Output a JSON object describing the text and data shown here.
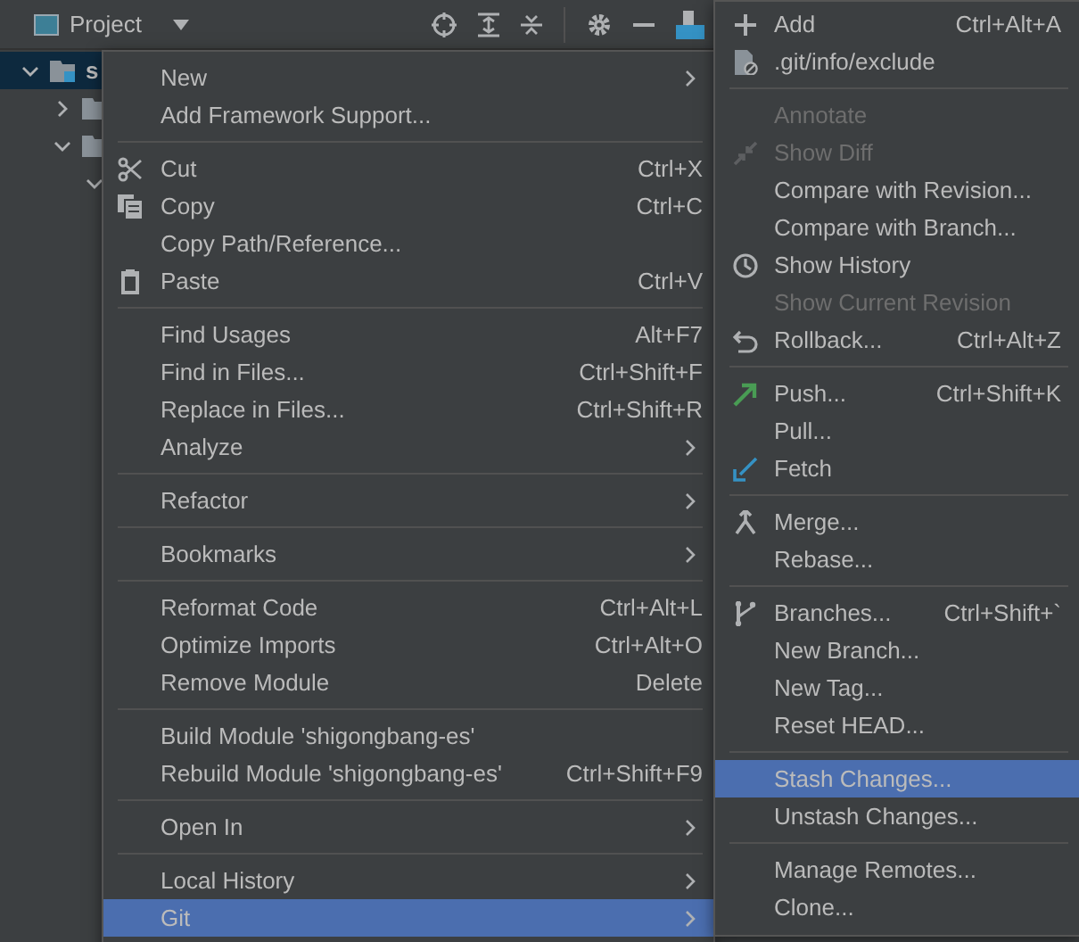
{
  "panel": {
    "title": "Project"
  },
  "tree": [
    {
      "label": "s",
      "selected": true,
      "expanded": true,
      "children": [
        {
          "expanded": false
        },
        {
          "expanded": true,
          "children": [
            {
              "expanded": true
            }
          ]
        }
      ]
    }
  ],
  "context_menu": {
    "groups": [
      [
        {
          "label": "New",
          "submenu": true,
          "selected": false
        },
        {
          "label": "Add Framework Support...",
          "selected": false
        }
      ],
      [
        {
          "label": "Cut",
          "kind": "scissors",
          "shortcut": "Ctrl+X",
          "selected": false
        },
        {
          "label": "Copy",
          "kind": "copy",
          "shortcut": "Ctrl+C",
          "selected": false
        },
        {
          "label": "Copy Path/Reference...",
          "selected": false
        },
        {
          "label": "Paste",
          "kind": "paste",
          "shortcut": "Ctrl+V",
          "selected": false
        }
      ],
      [
        {
          "label": "Find Usages",
          "shortcut": "Alt+F7",
          "selected": false
        },
        {
          "label": "Find in Files...",
          "shortcut": "Ctrl+Shift+F",
          "selected": false
        },
        {
          "label": "Replace in Files...",
          "shortcut": "Ctrl+Shift+R",
          "selected": false
        },
        {
          "label": "Analyze",
          "submenu": true,
          "selected": false
        }
      ],
      [
        {
          "label": "Refactor",
          "submenu": true,
          "selected": false
        }
      ],
      [
        {
          "label": "Bookmarks",
          "submenu": true,
          "selected": false
        }
      ],
      [
        {
          "label": "Reformat Code",
          "shortcut": "Ctrl+Alt+L",
          "selected": false
        },
        {
          "label": "Optimize Imports",
          "shortcut": "Ctrl+Alt+O",
          "selected": false
        },
        {
          "label": "Remove Module",
          "shortcut": "Delete",
          "selected": false
        }
      ],
      [
        {
          "label": "Build Module 'shigongbang-es'",
          "selected": false
        },
        {
          "label": "Rebuild Module 'shigongbang-es'",
          "shortcut": "Ctrl+Shift+F9",
          "selected": false
        }
      ],
      [
        {
          "label": "Open In",
          "submenu": true,
          "selected": false
        }
      ],
      [
        {
          "label": "Local History",
          "submenu": true,
          "selected": false
        },
        {
          "label": "Git",
          "submenu": true,
          "selected": true
        }
      ]
    ]
  },
  "git_submenu": {
    "groups": [
      [
        {
          "label": "Add",
          "kind": "plus",
          "shortcut": "Ctrl+Alt+A",
          "disabled": false,
          "selected": false
        },
        {
          "label": ".git/info/exclude",
          "kind": "file",
          "disabled": false,
          "selected": false
        }
      ],
      [
        {
          "label": "Annotate",
          "disabled": true,
          "selected": false
        },
        {
          "label": "Show Diff",
          "kind": "diff",
          "disabled": true,
          "selected": false
        },
        {
          "label": "Compare with Revision...",
          "disabled": false,
          "selected": false
        },
        {
          "label": "Compare with Branch...",
          "disabled": false,
          "selected": false
        },
        {
          "label": "Show History",
          "kind": "clock",
          "disabled": false,
          "selected": false
        },
        {
          "label": "Show Current Revision",
          "disabled": true,
          "selected": false
        },
        {
          "label": "Rollback...",
          "kind": "undo",
          "shortcut": "Ctrl+Alt+Z",
          "disabled": false,
          "selected": false
        }
      ],
      [
        {
          "label": "Push...",
          "kind": "push",
          "shortcut": "Ctrl+Shift+K",
          "disabled": false,
          "selected": false
        },
        {
          "label": "Pull...",
          "disabled": false,
          "selected": false
        },
        {
          "label": "Fetch",
          "kind": "fetch",
          "disabled": false,
          "selected": false
        }
      ],
      [
        {
          "label": "Merge...",
          "kind": "merge",
          "disabled": false,
          "selected": false
        },
        {
          "label": "Rebase...",
          "disabled": false,
          "selected": false
        }
      ],
      [
        {
          "label": "Branches...",
          "kind": "branch",
          "shortcut": "Ctrl+Shift+`",
          "disabled": false,
          "selected": false
        },
        {
          "label": "New Branch...",
          "disabled": false,
          "selected": false
        },
        {
          "label": "New Tag...",
          "disabled": false,
          "selected": false
        },
        {
          "label": "Reset HEAD...",
          "disabled": false,
          "selected": false
        }
      ],
      [
        {
          "label": "Stash Changes...",
          "disabled": false,
          "selected": true
        },
        {
          "label": "Unstash Changes...",
          "disabled": false,
          "selected": false
        }
      ],
      [
        {
          "label": "Manage Remotes...",
          "disabled": false,
          "selected": false
        },
        {
          "label": "Clone...",
          "disabled": false,
          "selected": false
        }
      ]
    ]
  }
}
